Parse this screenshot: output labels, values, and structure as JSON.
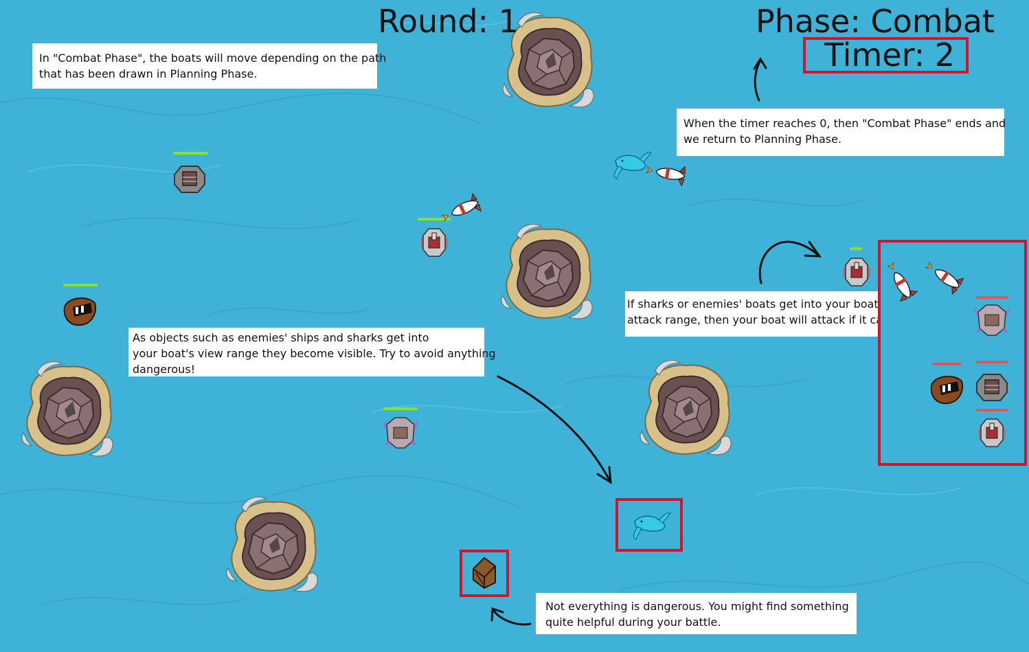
{
  "hud": {
    "round": "Round: 1",
    "phase": "Phase: Combat",
    "timer": "Timer: 2"
  },
  "notes": {
    "combat_phase": [
      "In \"Combat Phase\", the boats will move depending on the path",
      "that has been drawn in Planning Phase."
    ],
    "timer_end": [
      "When the timer reaches 0, then \"Combat Phase\" ends and",
      "we return to Planning Phase."
    ],
    "attack_range": [
      "If sharks or enemies' boats get into your boats'",
      "attack range, then your boat will attack if it can."
    ],
    "view_range": [
      "As objects such as enemies' ships and sharks get into",
      "your boat's view range they become visible. Try to avoid anything",
      "dangerous!"
    ],
    "not_dangerous": [
      "Not everything is dangerous. You might find something",
      "quite helpful during your battle."
    ]
  },
  "colors": {
    "sea": "#3fb2d8",
    "highlight": "#d4142e",
    "ally_health": "#8be02a",
    "enemy_health": "#e0575a",
    "rock_sand": "#d8c08a",
    "rock_stone": "#7d6264",
    "text_box": "#ffffff"
  },
  "icons": {
    "island": "rock-island-icon",
    "shark": "shark-icon",
    "rocket": "rocket-projectile-icon",
    "crate": "supply-crate-icon",
    "boat": "boat-icon"
  }
}
